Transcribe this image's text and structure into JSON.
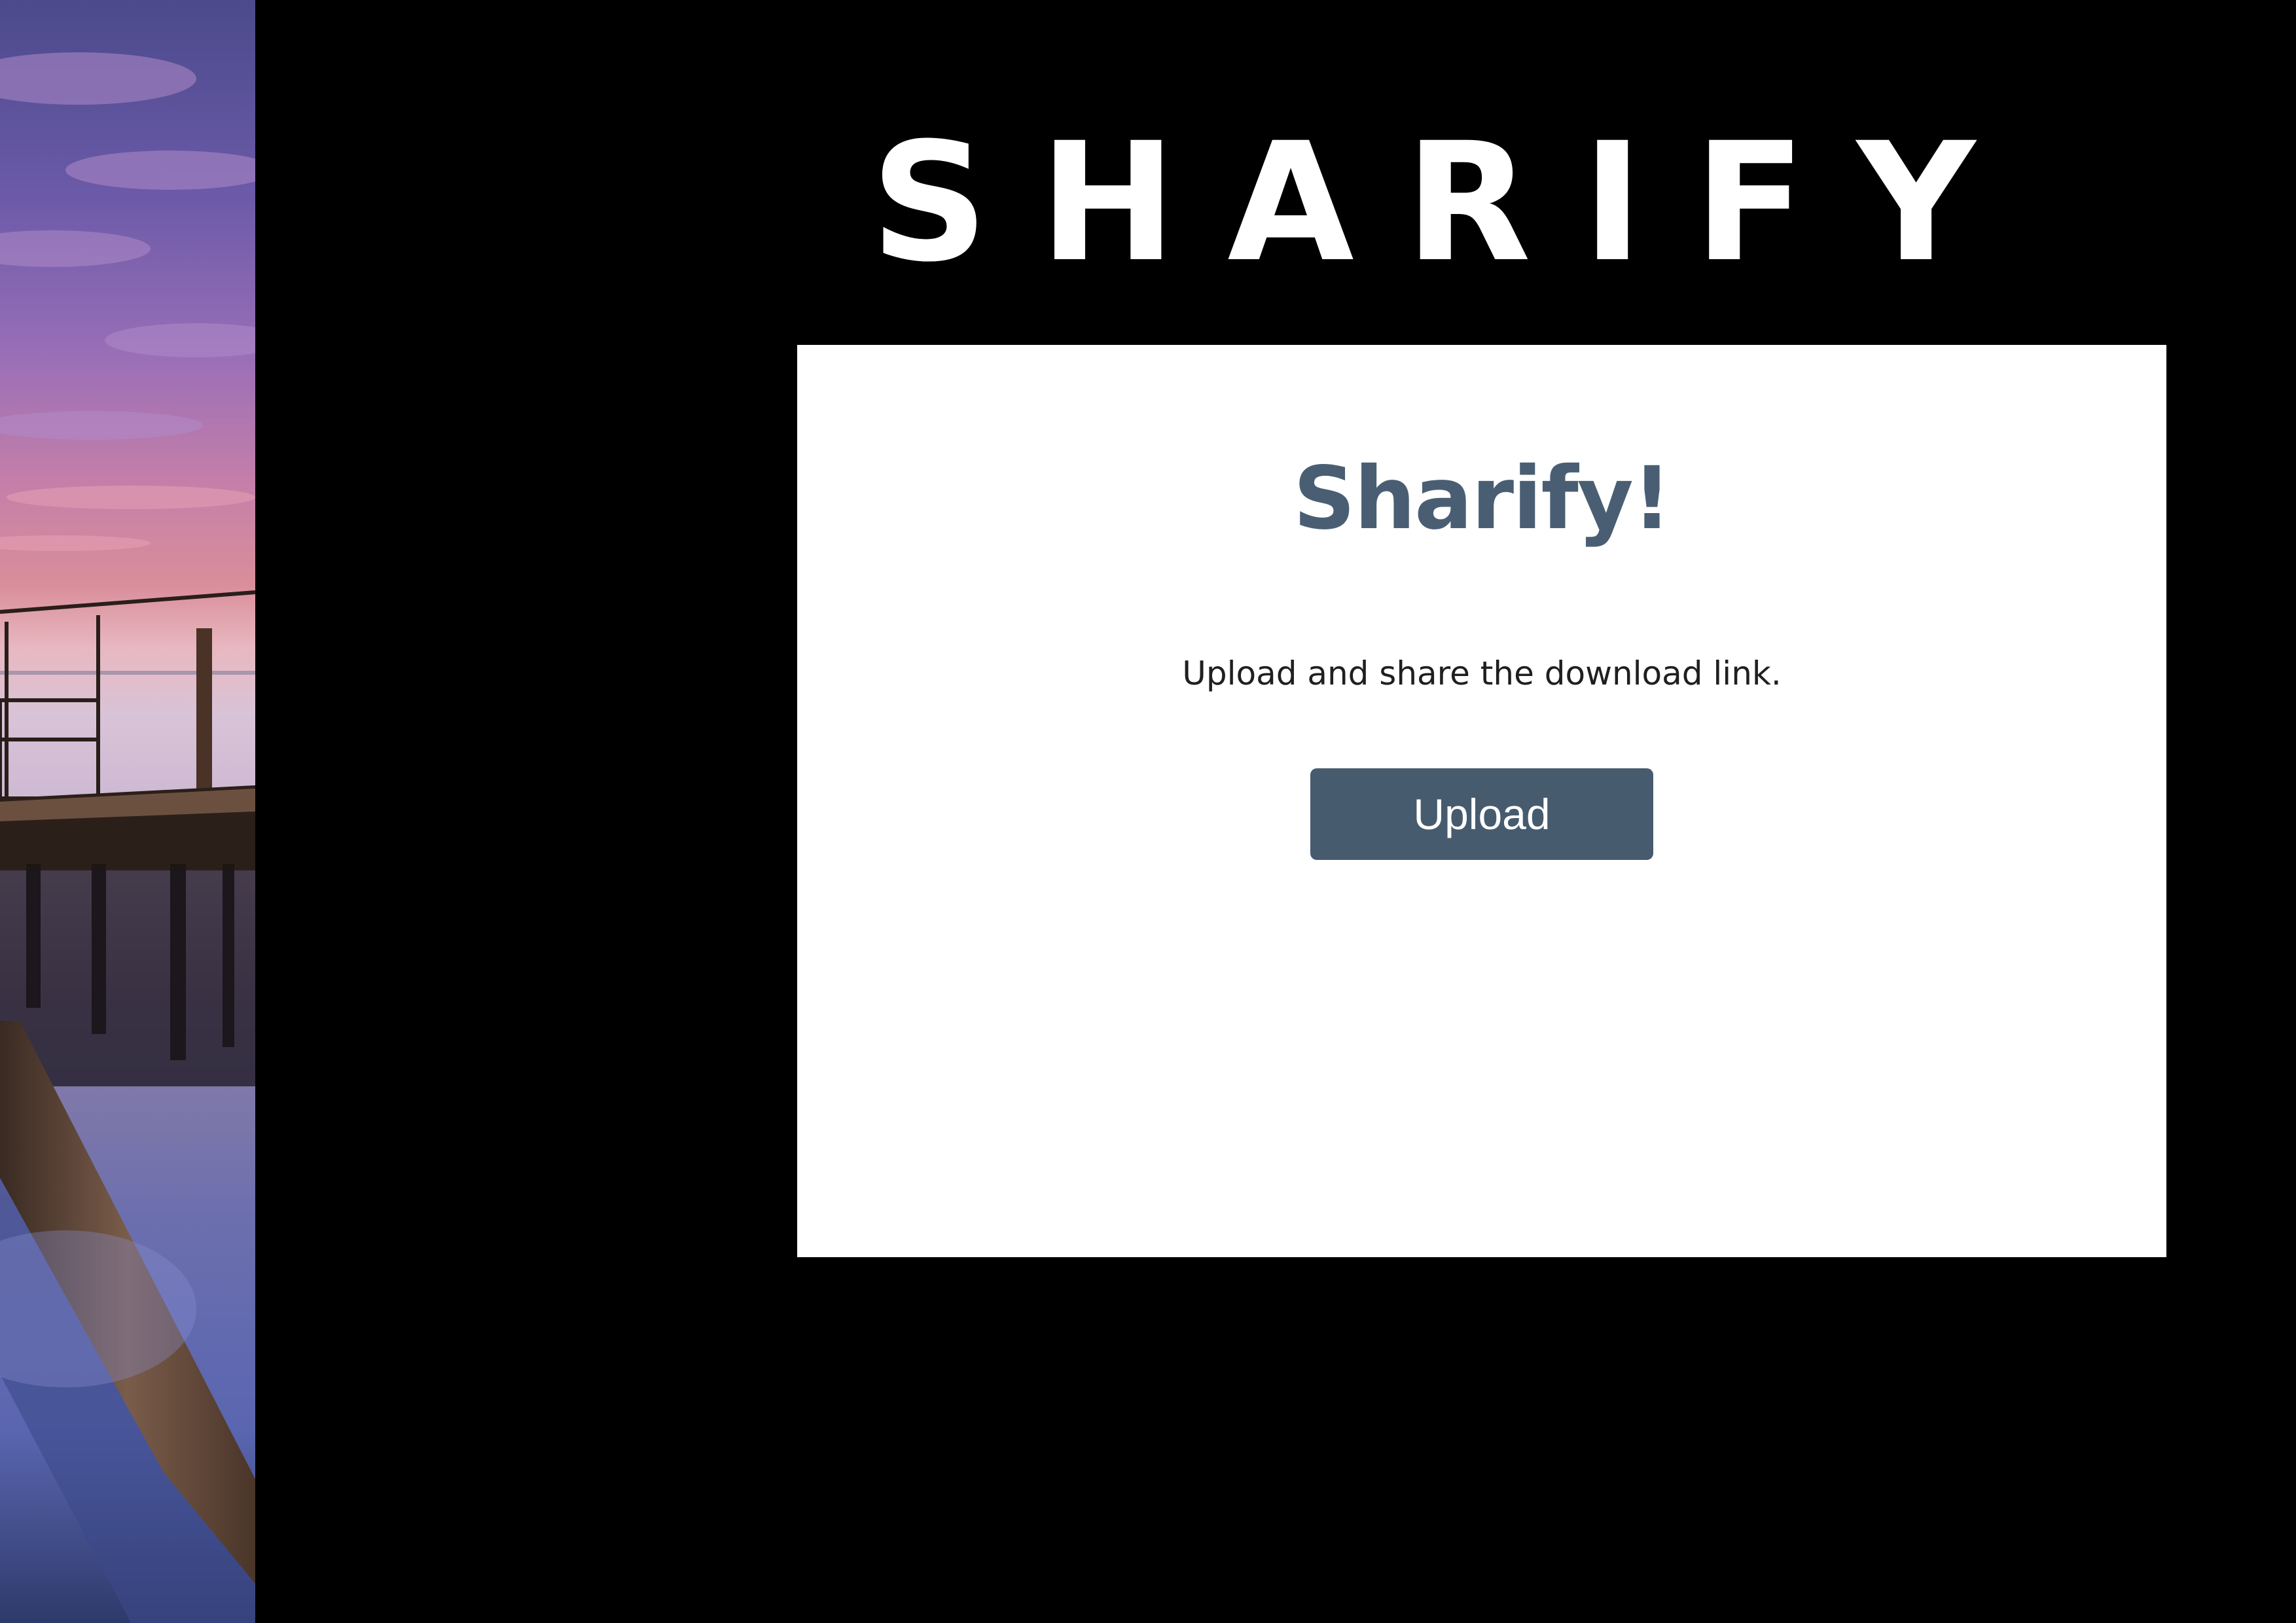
{
  "brand": {
    "title": "SHARIFY"
  },
  "card": {
    "title": "Sharify!",
    "subtitle": "Upload and share the download link.",
    "upload_label": "Upload"
  },
  "colors": {
    "page_background": "#000000",
    "card_background": "#ffffff",
    "heading_color": "#4a5e73",
    "button_color": "#475b6f",
    "button_text": "#ffffff"
  },
  "photo": {
    "description_icon": "sunset-pier-photo"
  }
}
